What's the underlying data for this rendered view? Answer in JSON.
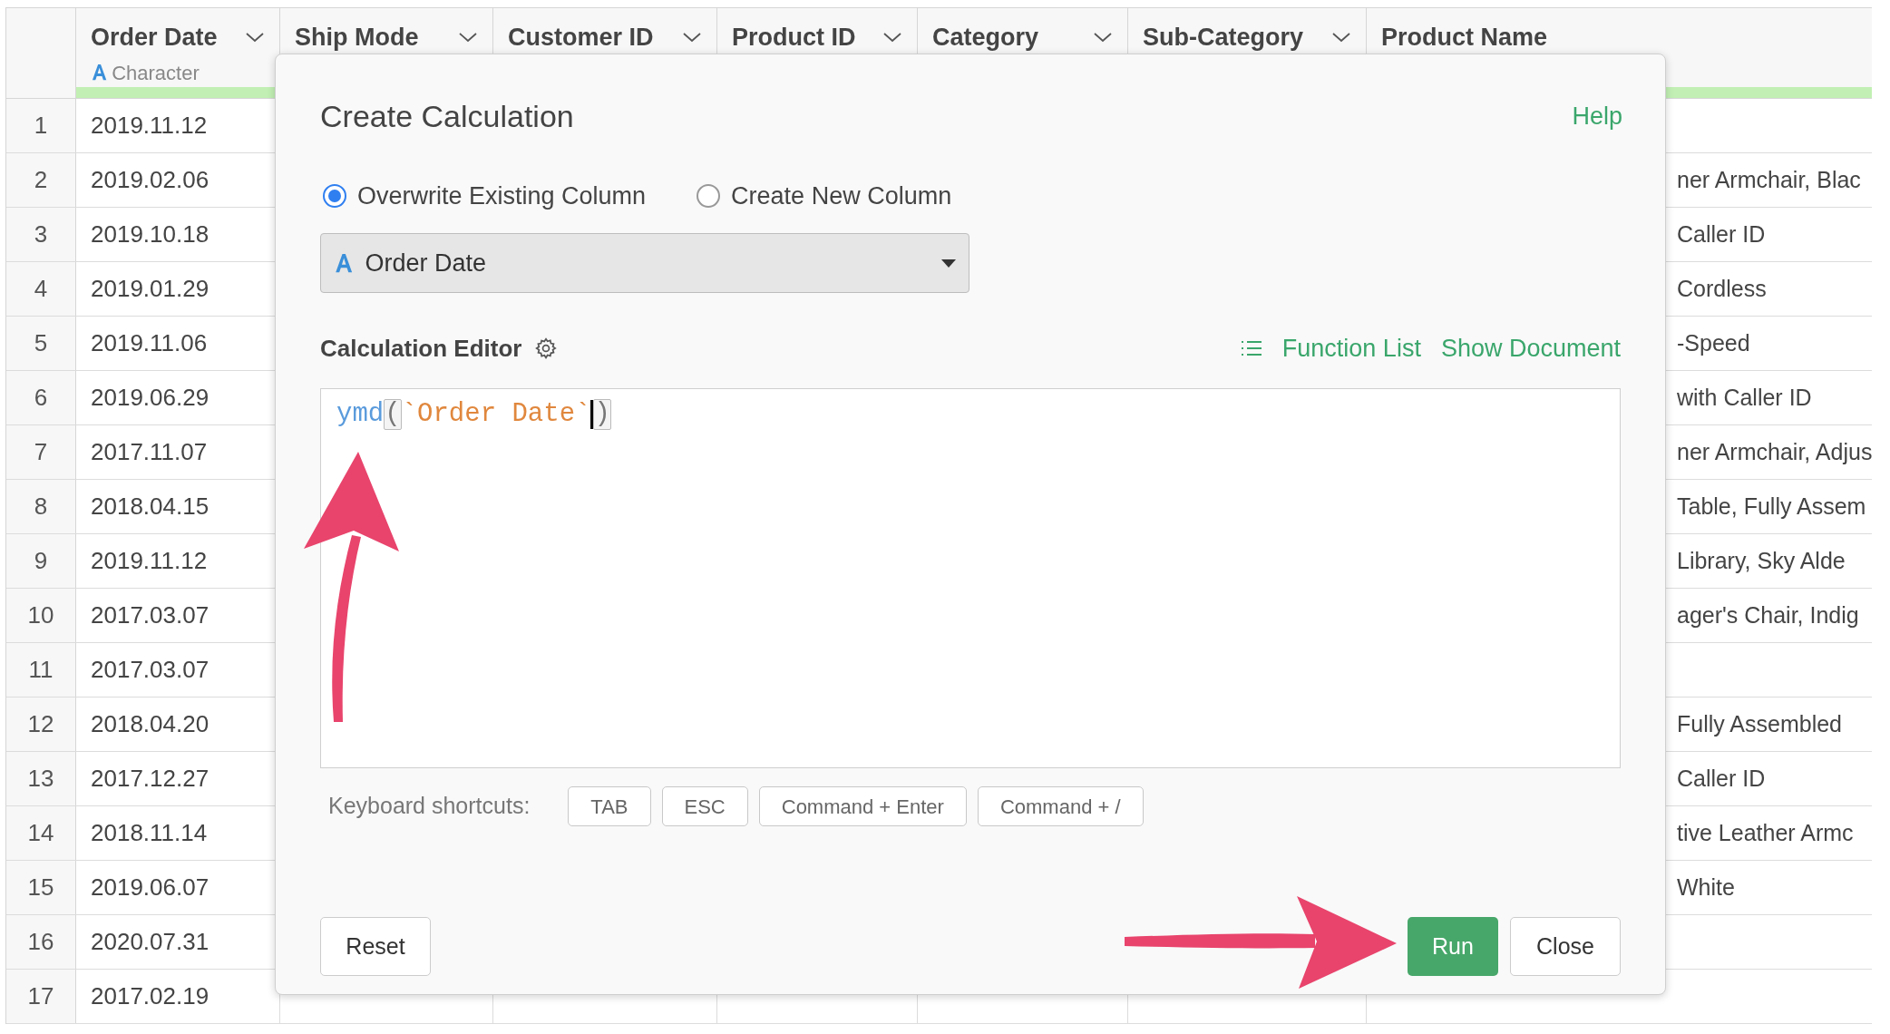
{
  "table": {
    "columns": [
      {
        "label": "Order Date",
        "has_menu": true,
        "subtitle": "Character"
      },
      {
        "label": "Ship Mode",
        "has_menu": true
      },
      {
        "label": "Customer ID",
        "has_menu": true
      },
      {
        "label": "Product ID",
        "has_menu": true
      },
      {
        "label": "Category",
        "has_menu": true
      },
      {
        "label": "Sub-Category",
        "has_menu": true
      },
      {
        "label": "Product Name",
        "has_menu": false
      }
    ],
    "rows": [
      {
        "number": "1",
        "order_date": "2019.11.12"
      },
      {
        "number": "2",
        "order_date": "2019.02.06",
        "product_name": "ner Armchair, Blac"
      },
      {
        "number": "3",
        "order_date": "2019.10.18",
        "product_name": "Caller ID"
      },
      {
        "number": "4",
        "order_date": "2019.01.29",
        "product_name": "Cordless"
      },
      {
        "number": "5",
        "order_date": "2019.11.06",
        "product_name": "-Speed"
      },
      {
        "number": "6",
        "order_date": "2019.06.29",
        "product_name": "with Caller ID"
      },
      {
        "number": "7",
        "order_date": "2017.11.07",
        "product_name": "ner Armchair, Adjus"
      },
      {
        "number": "8",
        "order_date": "2018.04.15",
        "product_name": "Table, Fully Assem"
      },
      {
        "number": "9",
        "order_date": "2019.11.12",
        "product_name": "Library, Sky Alde"
      },
      {
        "number": "10",
        "order_date": "2017.03.07",
        "product_name": "ager's Chair, Indig"
      },
      {
        "number": "11",
        "order_date": "2017.03.07"
      },
      {
        "number": "12",
        "order_date": "2018.04.20",
        "product_name": "Fully Assembled"
      },
      {
        "number": "13",
        "order_date": "2017.12.27",
        "product_name": "Caller ID"
      },
      {
        "number": "14",
        "order_date": "2018.11.14",
        "product_name": "tive Leather Armc"
      },
      {
        "number": "15",
        "order_date": "2019.06.07",
        "product_name": "White"
      },
      {
        "number": "16",
        "order_date": "2020.07.31"
      },
      {
        "number": "17",
        "order_date": "2017.02.19"
      }
    ]
  },
  "dialog": {
    "title": "Create Calculation",
    "help": "Help",
    "modes": [
      {
        "label": "Overwrite Existing Column",
        "selected": true
      },
      {
        "label": "Create New Column",
        "selected": false
      }
    ],
    "column_select": {
      "value": "Order Date"
    },
    "editor_label": "Calculation Editor",
    "links": [
      "Function List",
      "Show Document"
    ],
    "code": [
      {
        "kind": "function",
        "text": "ymd"
      },
      {
        "kind": "paren",
        "text": "(",
        "highlighted": true
      },
      {
        "kind": "string",
        "text": "`Order Date`"
      },
      {
        "kind": "cursor"
      },
      {
        "kind": "paren",
        "text": ")",
        "highlighted": true
      }
    ],
    "shortcuts_label": "Keyboard shortcuts:",
    "shortcuts": [
      "TAB",
      "ESC",
      "Command + Enter",
      "Command + /"
    ],
    "buttons": {
      "reset": "Reset",
      "run": "Run",
      "close": "Close"
    }
  }
}
